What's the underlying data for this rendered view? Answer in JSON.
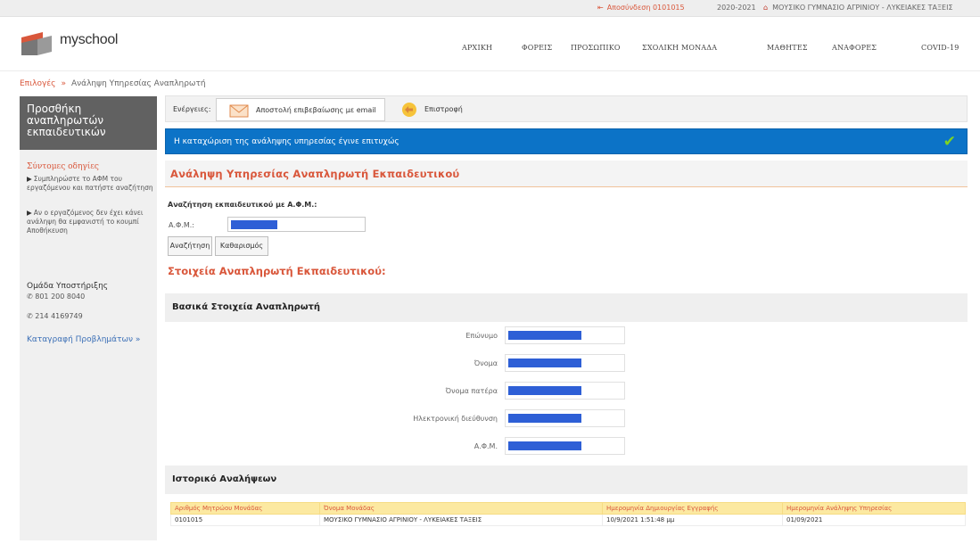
{
  "topbar": {
    "logout": "Αποσύνδεση 0101015",
    "school_year": "2020-2021",
    "school": "ΜΟΥΣΙΚΟ ΓΥΜΝΑΣΙΟ ΑΓΡΙΝΙΟΥ - ΛΥΚΕΙΑΚΕΣ ΤΑΞΕΙΣ"
  },
  "header": {
    "logo": "myschool",
    "nav": [
      "ΑΡΧΙΚΗ",
      "ΦΟΡΕΙΣ",
      "ΠΡΟΣΩΠΙΚΟ",
      "ΣΧΟΛΙΚΗ ΜΟΝΑΔΑ",
      "ΜΑΘΗΤΕΣ",
      "ΑΝΑΦΟΡΕΣ",
      "COVID-19"
    ]
  },
  "breadcrumb": {
    "link": "Επιλογές",
    "separator": "»",
    "current": "Ανάληψη Υπηρεσίας Αναπληρωτή"
  },
  "sidebar": {
    "title": "Προσθήκη αναπληρωτών εκπαιδευτικών",
    "hints_title": "Σύντομες οδηγίες",
    "hints": [
      "Συμπληρώστε το ΑΦΜ του εργαζόμενου και πατήστε αναζήτηση",
      "Αν ο εργαζόμενος δεν έχει κάνει ανάληψη θα εμφανιστή το κουμπί Αποθήκευση"
    ],
    "support_title": "Ομάδα Υποστήριξης",
    "phones": [
      "801 200 8040",
      "214 4169749"
    ],
    "report_link": "Καταγραφή Προβλημάτων »"
  },
  "actions": {
    "label": "Ενέργειες:",
    "email_button": "Αποστολή επιβεβαίωσης με email",
    "back_button": "Επιστροφή"
  },
  "alert": {
    "message": "Η καταχώριση της ανάληψης υπηρεσίας έγινε επιτυχώς",
    "color": "#0c73c7"
  },
  "form": {
    "title": "Ανάληψη Υπηρεσίας Αναπληρωτή Εκπαιδευτικού",
    "search_heading": "Αναζήτηση εκπαιδευτικού με Α.Φ.Μ.:",
    "afm_label": "Α.Φ.Μ.:",
    "search_button": "Αναζήτηση",
    "clear_button": "Καθαρισμός",
    "teacher_heading": "Στοιχεία Αναπληρωτή Εκπαιδευτικού:"
  },
  "basic": {
    "title": "Βασικά Στοιχεία Αναπληρωτή",
    "fields": [
      "Επώνυμο",
      "Όνομα",
      "Όνομα πατέρα",
      "Ηλεκτρονική διεύθυνση",
      "Α.Φ.Μ."
    ]
  },
  "history": {
    "title": "Ιστορικό Αναλήψεων",
    "columns": [
      "Αριθμός Μητρώου Μονάδας",
      "Όνομα Μονάδας",
      "Ημερομηνία Δημιουργίας Εγγραφής",
      "Ημερομηνία Ανάληψης Υπηρεσίας"
    ],
    "rows": [
      [
        "0101015",
        "ΜΟΥΣΙΚΟ ΓΥΜΝΑΣΙΟ ΑΓΡΙΝΙΟΥ - ΛΥΚΕΙΑΚΕΣ ΤΑΞΕΙΣ",
        "10/9/2021 1:51:48 μμ",
        "01/09/2021"
      ]
    ]
  },
  "colors": {
    "accent": "#d9573b",
    "link": "#3b6fb6",
    "redaction": "#2e5fd6"
  }
}
